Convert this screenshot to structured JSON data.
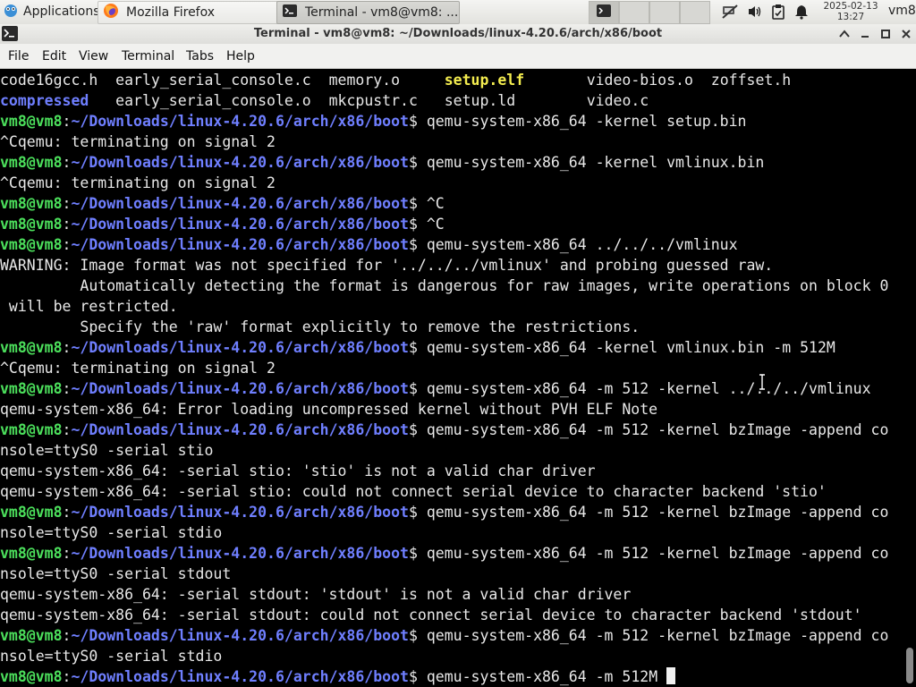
{
  "taskbar": {
    "apps_label": "Applications",
    "tasks": [
      {
        "label": "Mozilla Firefox",
        "icon": "firefox-icon"
      },
      {
        "label": "Terminal - vm8@vm8: ...",
        "icon": "terminal-icon"
      }
    ],
    "clock_date": "2025-02-13",
    "clock_time": "13:27",
    "username": "vm8"
  },
  "window": {
    "title": "Terminal - vm8@vm8: ~/Downloads/linux-4.20.6/arch/x86/boot"
  },
  "menu": [
    "File",
    "Edit",
    "View",
    "Terminal",
    "Tabs",
    "Help"
  ],
  "terminal": {
    "prompt_user": "vm8@vm8",
    "prompt_path": "~/Downloads/linux-4.20.6/arch/x86/boot",
    "listing": [
      [
        {
          "text": "code16gcc.h",
          "cls": ""
        },
        {
          "text": "early_serial_console.c",
          "cls": ""
        },
        {
          "text": "memory.o",
          "cls": ""
        },
        {
          "text": "setup.elf",
          "cls": "g"
        },
        {
          "text": "video-bios.o",
          "cls": ""
        },
        {
          "text": "zoffset.h",
          "cls": ""
        }
      ],
      [
        {
          "text": "compressed",
          "cls": "d"
        },
        {
          "text": "early_serial_console.o",
          "cls": ""
        },
        {
          "text": "mkcpustr.c",
          "cls": ""
        },
        {
          "text": "setup.ld",
          "cls": ""
        },
        {
          "text": "video.c",
          "cls": ""
        }
      ]
    ],
    "lines": [
      {
        "type": "prompt",
        "cmd": "qemu-system-x86_64 -kernel setup.bin"
      },
      {
        "type": "out",
        "text": "^Cqemu: terminating on signal 2"
      },
      {
        "type": "prompt",
        "cmd": "qemu-system-x86_64 -kernel vmlinux.bin"
      },
      {
        "type": "out",
        "text": "^Cqemu: terminating on signal 2"
      },
      {
        "type": "prompt",
        "cmd": "^C"
      },
      {
        "type": "prompt",
        "cmd": "^C"
      },
      {
        "type": "prompt",
        "cmd": "qemu-system-x86_64 ../../../vmlinux"
      },
      {
        "type": "out",
        "text": "WARNING: Image format was not specified for '../../../vmlinux' and probing guessed raw."
      },
      {
        "type": "out",
        "text": "         Automatically detecting the format is dangerous for raw images, write operations on block 0"
      },
      {
        "type": "out",
        "text": " will be restricted."
      },
      {
        "type": "out",
        "text": "         Specify the 'raw' format explicitly to remove the restrictions."
      },
      {
        "type": "prompt",
        "cmd": "qemu-system-x86_64 -kernel vmlinux.bin -m 512M"
      },
      {
        "type": "out",
        "text": "^Cqemu: terminating on signal 2"
      },
      {
        "type": "prompt",
        "cmd": "qemu-system-x86_64 -m 512 -kernel ../../../vmlinux"
      },
      {
        "type": "out",
        "text": "qemu-system-x86_64: Error loading uncompressed kernel without PVH ELF Note"
      },
      {
        "type": "prompt",
        "cmd": "qemu-system-x86_64 -m 512 -kernel bzImage -append co"
      },
      {
        "type": "out",
        "text": "nsole=ttyS0 -serial stio"
      },
      {
        "type": "out",
        "text": "qemu-system-x86_64: -serial stio: 'stio' is not a valid char driver"
      },
      {
        "type": "out",
        "text": "qemu-system-x86_64: -serial stio: could not connect serial device to character backend 'stio'"
      },
      {
        "type": "prompt",
        "cmd": "qemu-system-x86_64 -m 512 -kernel bzImage -append co"
      },
      {
        "type": "out",
        "text": "nsole=ttyS0 -serial stdio"
      },
      {
        "type": "prompt",
        "cmd": "qemu-system-x86_64 -m 512 -kernel bzImage -append co"
      },
      {
        "type": "out",
        "text": "nsole=ttyS0 -serial stdout"
      },
      {
        "type": "out",
        "text": "qemu-system-x86_64: -serial stdout: 'stdout' is not a valid char driver"
      },
      {
        "type": "out",
        "text": "qemu-system-x86_64: -serial stdout: could not connect serial device to character backend 'stdout'"
      },
      {
        "type": "prompt",
        "cmd": "qemu-system-x86_64 -m 512 -kernel bzImage -append co"
      },
      {
        "type": "out",
        "text": "nsole=ttyS0 -serial stdio"
      },
      {
        "type": "prompt",
        "cmd": "qemu-system-x86_64 -m 512M ",
        "cursor": true
      }
    ]
  },
  "colors": {
    "prompt_user": "#4ce05c",
    "prompt_path": "#6f7fff",
    "executable": "#f3ec4f",
    "directory": "#6f7fff"
  }
}
